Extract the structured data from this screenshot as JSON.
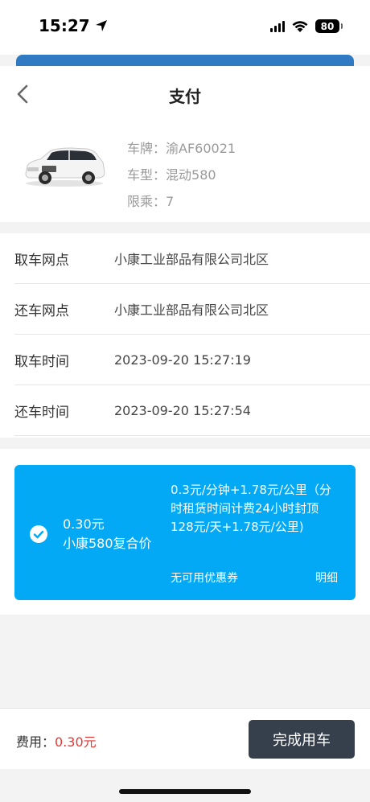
{
  "status_bar": {
    "time": "15:27",
    "battery": "80"
  },
  "header": {
    "title": "支付"
  },
  "car": {
    "plate_label": "车牌：",
    "plate": "渝AF60021",
    "model_label": "车型：",
    "model": "混动580",
    "seats_label": "限乘：",
    "seats": "7"
  },
  "details": [
    {
      "label": "取车网点",
      "value": "小康工业部品有限公司北区"
    },
    {
      "label": "还车网点",
      "value": "小康工业部品有限公司北区"
    },
    {
      "label": "取车时间",
      "value": "2023-09-20 15:27:19"
    },
    {
      "label": "还车时间",
      "value": "2023-09-20 15:27:54"
    }
  ],
  "price_card": {
    "amount": "0.30元",
    "plan_name": "小康580复合价",
    "rule": "0.3元/分钟+1.78元/公里（分时租赁时间计费24小时封顶128元/天+1.78元/公里)",
    "coupon_text": "无可用优惠券",
    "detail_link": "明细",
    "accent_color": "#03a9f4"
  },
  "footer": {
    "fee_label": "费用：",
    "fee_value": "0.30元",
    "button_label": "完成用车",
    "fee_color": "#e53935"
  }
}
